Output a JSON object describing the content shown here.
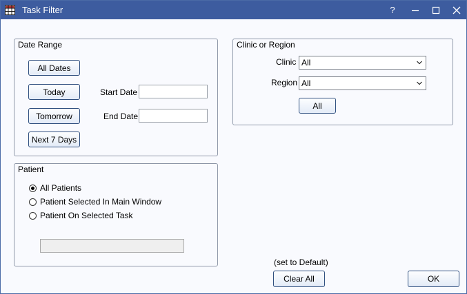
{
  "window": {
    "title": "Task Filter",
    "help_label": "?"
  },
  "date_range": {
    "title": "Date Range",
    "buttons": {
      "all_dates": "All Dates",
      "today": "Today",
      "tomorrow": "Tomorrow",
      "next_7_days": "Next 7 Days"
    },
    "start_date_label": "Start Date",
    "start_date_value": "",
    "end_date_label": "End Date",
    "end_date_value": ""
  },
  "clinic_region": {
    "title": "Clinic or Region",
    "clinic_label": "Clinic",
    "clinic_value": "All",
    "region_label": "Region",
    "region_value": "All",
    "all_button": "All"
  },
  "patient": {
    "title": "Patient",
    "options": [
      {
        "label": "All Patients",
        "checked": true
      },
      {
        "label": "Patient Selected In Main Window",
        "checked": false
      },
      {
        "label": "Patient On Selected Task",
        "checked": false
      }
    ],
    "patient_field_value": ""
  },
  "footer": {
    "set_default_label": "(set to Default)",
    "clear_all_label": "Clear All",
    "ok_label": "OK"
  },
  "icons": {
    "app": "grid-icon",
    "minimize": "minimize-icon",
    "maximize": "maximize-icon",
    "close": "close-icon"
  },
  "colors": {
    "titlebar": "#3d5c9f",
    "button_border": "#2f4f7f"
  }
}
